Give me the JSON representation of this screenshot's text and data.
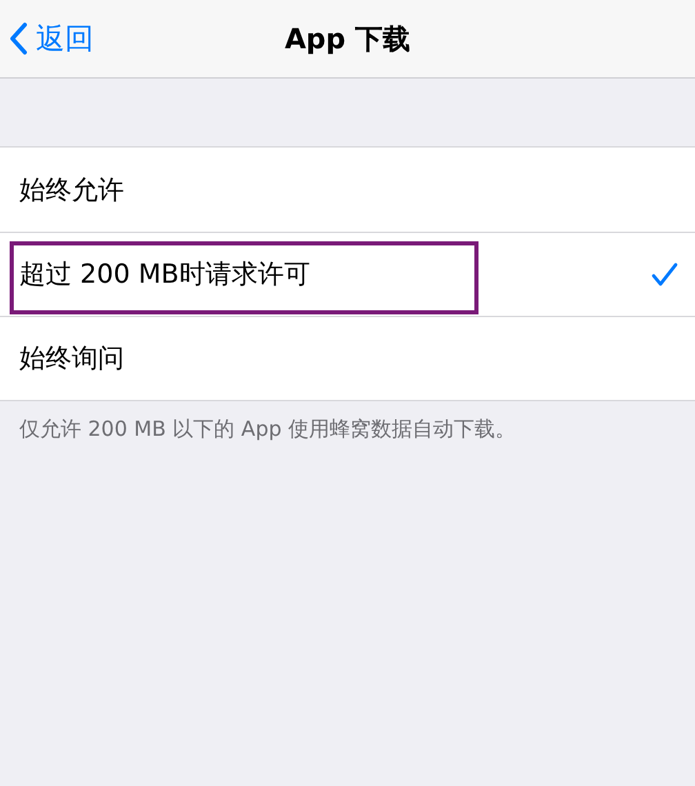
{
  "nav_bar": {
    "back_label": "返回",
    "title": "App 下载"
  },
  "options": [
    {
      "label": "始终允许",
      "selected": false,
      "highlighted": false
    },
    {
      "label": "超过 200 MB时请求许可",
      "selected": true,
      "highlighted": true
    },
    {
      "label": "始终询问",
      "selected": false,
      "highlighted": false
    }
  ],
  "footer_note": "仅允许 200 MB 以下的 App 使用蜂窝数据自动下载。"
}
